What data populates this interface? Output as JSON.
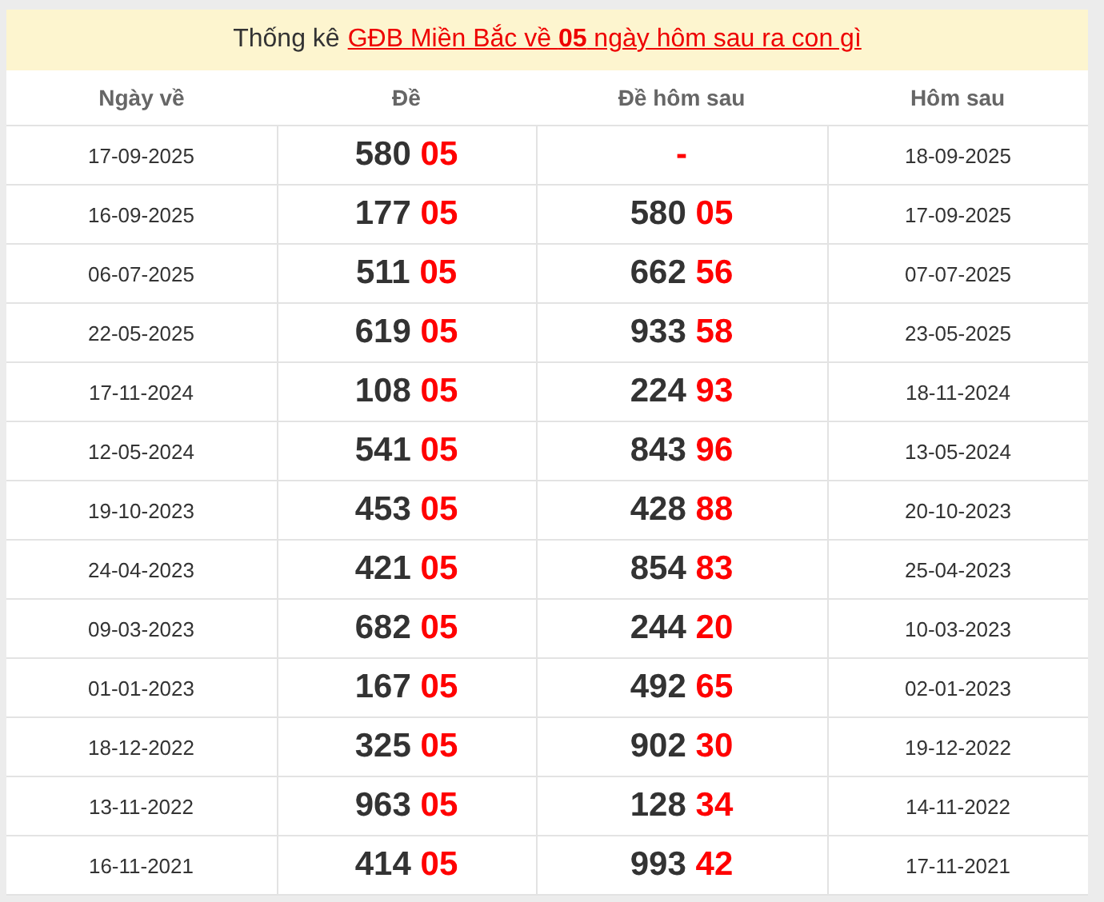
{
  "title": {
    "prefix": "Thống kê",
    "link": "GĐB Miền Bắc về **05** ngày hôm sau ra con gì"
  },
  "columns": [
    "Ngày về",
    "Đề",
    "Đề hôm sau",
    "Hôm sau"
  ],
  "rows": [
    {
      "date": "17-09-2025",
      "de": {
        "head": "580",
        "tail": "05"
      },
      "next": {
        "tail": "-"
      },
      "next_date": "18-09-2025"
    },
    {
      "date": "16-09-2025",
      "de": {
        "head": "177",
        "tail": "05"
      },
      "next": {
        "head": "580",
        "tail": "05"
      },
      "next_date": "17-09-2025"
    },
    {
      "date": "06-07-2025",
      "de": {
        "head": "511",
        "tail": "05"
      },
      "next": {
        "head": "662",
        "tail": "56"
      },
      "next_date": "07-07-2025"
    },
    {
      "date": "22-05-2025",
      "de": {
        "head": "619",
        "tail": "05"
      },
      "next": {
        "head": "933",
        "tail": "58"
      },
      "next_date": "23-05-2025"
    },
    {
      "date": "17-11-2024",
      "de": {
        "head": "108",
        "tail": "05"
      },
      "next": {
        "head": "224",
        "tail": "93"
      },
      "next_date": "18-11-2024"
    },
    {
      "date": "12-05-2024",
      "de": {
        "head": "541",
        "tail": "05"
      },
      "next": {
        "head": "843",
        "tail": "96"
      },
      "next_date": "13-05-2024"
    },
    {
      "date": "19-10-2023",
      "de": {
        "head": "453",
        "tail": "05"
      },
      "next": {
        "head": "428",
        "tail": "88"
      },
      "next_date": "20-10-2023"
    },
    {
      "date": "24-04-2023",
      "de": {
        "head": "421",
        "tail": "05"
      },
      "next": {
        "head": "854",
        "tail": "83"
      },
      "next_date": "25-04-2023"
    },
    {
      "date": "09-03-2023",
      "de": {
        "head": "682",
        "tail": "05"
      },
      "next": {
        "head": "244",
        "tail": "20"
      },
      "next_date": "10-03-2023"
    },
    {
      "date": "01-01-2023",
      "de": {
        "head": "167",
        "tail": "05"
      },
      "next": {
        "head": "492",
        "tail": "65"
      },
      "next_date": "02-01-2023"
    },
    {
      "date": "18-12-2022",
      "de": {
        "head": "325",
        "tail": "05"
      },
      "next": {
        "head": "902",
        "tail": "30"
      },
      "next_date": "19-12-2022"
    },
    {
      "date": "13-11-2022",
      "de": {
        "head": "963",
        "tail": "05"
      },
      "next": {
        "head": "128",
        "tail": "34"
      },
      "next_date": "14-11-2022"
    },
    {
      "date": "16-11-2021",
      "de": {
        "head": "414",
        "tail": "05"
      },
      "next": {
        "head": "993",
        "tail": "42"
      },
      "next_date": "17-11-2021"
    }
  ]
}
